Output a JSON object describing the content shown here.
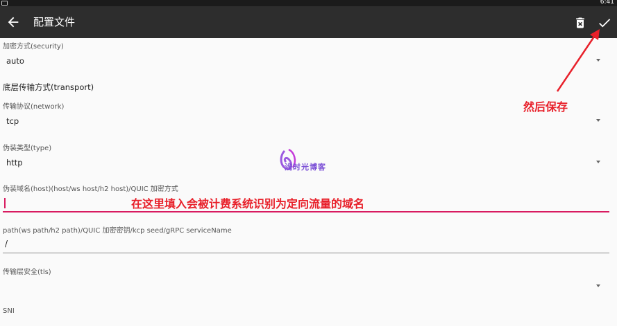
{
  "status_bar": {
    "time": "6:41"
  },
  "app_bar": {
    "title": "配置文件",
    "back_icon": "arrow-left-icon",
    "delete_icon": "delete-icon",
    "save_icon": "check-icon"
  },
  "fields": {
    "security": {
      "label": "加密方式(security)",
      "value": "auto"
    },
    "section_title": "底层传输方式(transport)",
    "network": {
      "label": "传输协议(network)",
      "value": "tcp"
    },
    "type": {
      "label": "伪装类型(type)",
      "value": "http"
    },
    "host": {
      "label": "伪装域名(host)(host/ws host/h2 host)/QUIC 加密方式",
      "value": ""
    },
    "path": {
      "label": "path(ws path/h2 path)/QUIC 加密密钥/kcp seed/gRPC serviceName",
      "value": "/"
    },
    "tls": {
      "label": "传输层安全(tls)",
      "value": ""
    },
    "sni": {
      "label": "SNI"
    }
  },
  "annotations": {
    "save_note": "然后保存",
    "host_note": "在这里填入会被计费系统识别为定向流量的域名",
    "color": "#e8202a"
  },
  "watermark": {
    "text": "浅时光博客"
  }
}
